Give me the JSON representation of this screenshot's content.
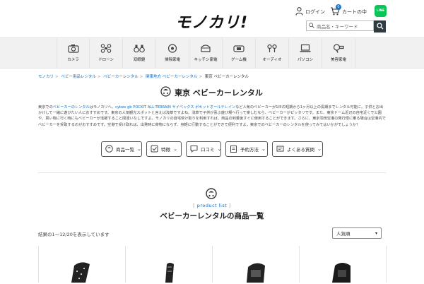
{
  "header": {
    "logo": "モノカリ!",
    "login_label": "ログイン",
    "cart_label": "カートの中",
    "cart_count": "0",
    "line_label": "LINE",
    "search_placeholder": "商品名・キーワード"
  },
  "categories": [
    {
      "label": "カメラ",
      "icon": "camera-icon"
    },
    {
      "label": "ドローン",
      "icon": "drone-icon"
    },
    {
      "label": "双眼鏡",
      "icon": "binoculars-icon"
    },
    {
      "label": "掃除家電",
      "icon": "robot-vacuum-icon"
    },
    {
      "label": "キッチン家電",
      "icon": "rice-cooker-icon"
    },
    {
      "label": "ゲーム機",
      "icon": "game-console-icon"
    },
    {
      "label": "オーディオ",
      "icon": "earbuds-icon"
    },
    {
      "label": "パソコン",
      "icon": "laptop-icon"
    },
    {
      "label": "美容家電",
      "icon": "hair-dryer-icon"
    }
  ],
  "breadcrumb": {
    "items": [
      "モノカリ",
      "ベビー用品レンタル",
      "ベビーカーレンタル",
      "関東地方 ベビーカーレンタル"
    ],
    "current": "東京 ベビーカーレンタル"
  },
  "page": {
    "title": "東京 ベビーカーレンタル",
    "desc_1": "東京での",
    "desc_link1": "ベビーカーのレンタル",
    "desc_2": "はモノカリへ。",
    "desc_link2": "cybex gb POCKIT ALL-TERRAIN サイベックス ポキットオールテレイン",
    "desc_3": "など人気のベビーカーが1日の短期から1ヶ月以上の長期までレンタル可能に。子供とお出かけして一緒に遊びたい人におすすめです。東京の人気観光スポットと言えば浅草ですよね。浅草で子供が喜ぶ遊び場へ行って楽しむなら、ベビーカーがピッタリです。また、東京ドーム近辺の自宅近くで公園や、買い物に行く時にもベビーカーが活躍すること間違いなしですよ。モノカリの自宅受け取りを利用すれば、商品の到着後すぐに使用することができます。さらに、東京羽田空港の発行便に乗る場合は空港内でベビーカーを受取するのがおすすめです。空港で受け取れば、出発時に荷物にならず、身軽に行動することができて便利ですよ。東京でのベビーカーのレンタルを使ってみてはいかがでしょうか？"
  },
  "tabs": [
    {
      "label": "商品一覧",
      "icon": "stroller-icon"
    },
    {
      "label": "特徴",
      "icon": "feature-icon"
    },
    {
      "label": "口コミ",
      "icon": "review-icon"
    },
    {
      "label": "予約方法",
      "icon": "clipboard-icon"
    },
    {
      "label": "よくある質問",
      "icon": "faq-icon"
    }
  ],
  "products": {
    "subtitle": "product list",
    "title": "ベビーカーレンタルの商品一覧",
    "count_text": "結果の1〜12/20を表示しています",
    "sort_selected": "人気順"
  }
}
